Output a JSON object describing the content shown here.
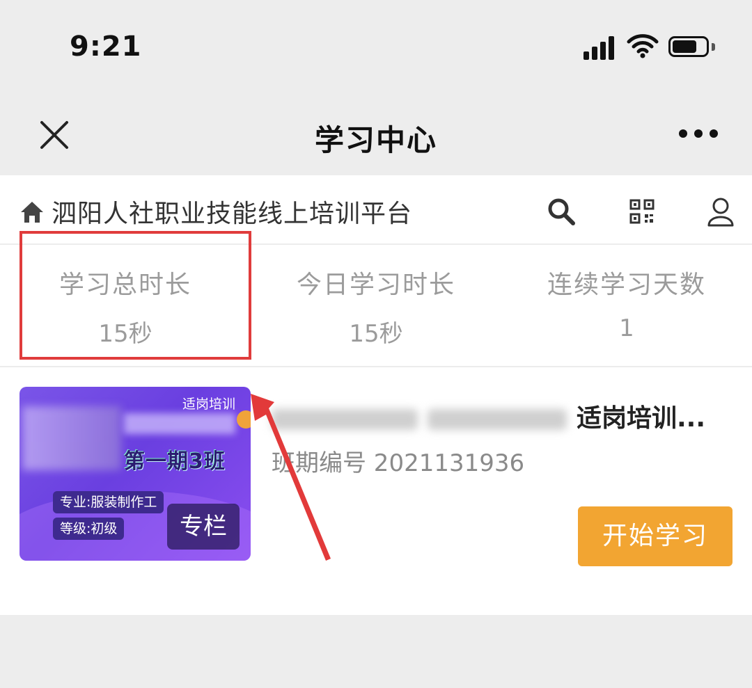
{
  "status_bar": {
    "time": "9:21"
  },
  "nav": {
    "title": "学习中心"
  },
  "site": {
    "title": "泗阳人社职业技能线上培训平台"
  },
  "stats": [
    {
      "label": "学习总时长",
      "value": "15秒"
    },
    {
      "label": "今日学习时长",
      "value": "15秒"
    },
    {
      "label": "连续学习天数",
      "value": "1"
    }
  ],
  "course": {
    "thumbnail": {
      "tag": "适岗培训",
      "issue": "第一期3班",
      "major": "专业:服装制作工",
      "level": "等级:初级",
      "badge": "专栏"
    },
    "title_suffix": "适岗培训...",
    "code": "班期编号 2021131936",
    "start_button": "开始学习"
  },
  "colors": {
    "accent": "#f2a532",
    "highlight": "#e03c3c",
    "thumbnail": "#6a3fe0"
  },
  "icons": [
    "close-icon",
    "more-icon",
    "home-icon",
    "search-icon",
    "qrcode-icon",
    "user-icon",
    "signal-icon",
    "wifi-icon",
    "battery-icon"
  ]
}
